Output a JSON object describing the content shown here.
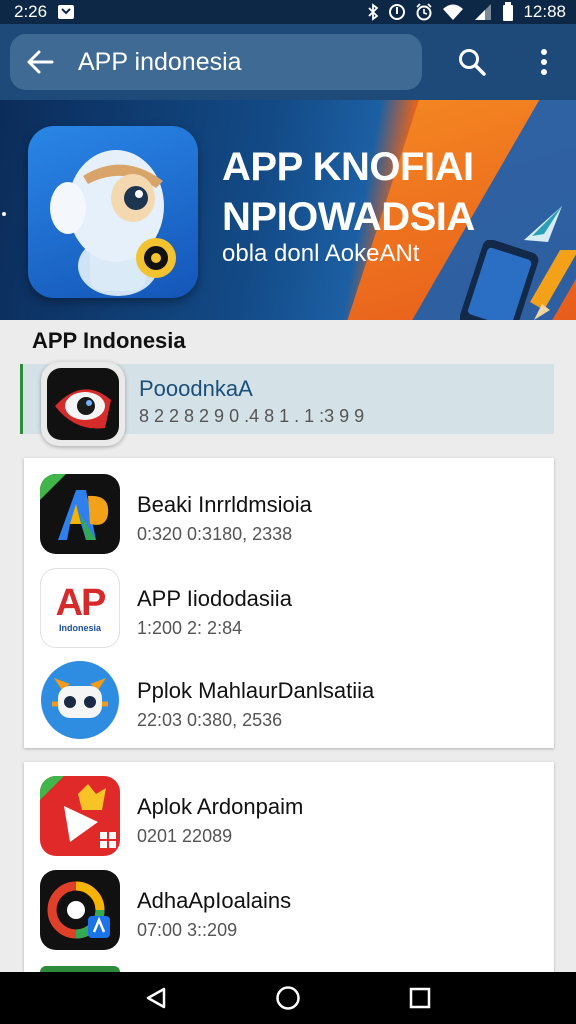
{
  "status_bar": {
    "time_left": "2:26",
    "time_right": "12:88",
    "icons": [
      "notification-icon",
      "bluetooth-icon",
      "do-not-disturb-icon",
      "alarm-icon",
      "wifi-icon",
      "signal-icon",
      "battery-icon"
    ]
  },
  "app_bar": {
    "search_text": "APP indonesia",
    "icons": [
      "back-arrow-icon",
      "search-icon",
      "more-vert-icon"
    ]
  },
  "banner": {
    "title_line1": "APP KNOFIAI",
    "title_line2": "NPIOWADSIA",
    "subtitle": "obla donl AokeANt"
  },
  "section": {
    "title": "APP Indonesia"
  },
  "highlighted_app": {
    "name": "PooodnkaA",
    "meta": "8 2 2 8  2 9 0 .4 8 1 .  1 :3 9 9",
    "accent_color": "#2e8b3a"
  },
  "card_1": {
    "apps": [
      {
        "name": "Beaki Inrrldmsioia",
        "meta": "0:320  0:3180, 2338"
      },
      {
        "name": "APP Iiododasiia",
        "meta": "1:200  2: 2:84",
        "icon_text": "AP",
        "icon_subtext": "Indonesia"
      },
      {
        "name": "Pplok MahlaurDanlsatiia",
        "meta": "22:03  0:380, 2536"
      }
    ]
  },
  "card_2": {
    "apps": [
      {
        "name": "Aplok Ardonpaim",
        "meta": "0201  22089"
      },
      {
        "name": "AdhaApIoalains",
        "meta": "07:00  3::209"
      }
    ]
  },
  "nav_bar": {
    "icons": [
      "back-triangle-icon",
      "home-circle-icon",
      "recents-square-icon"
    ]
  }
}
